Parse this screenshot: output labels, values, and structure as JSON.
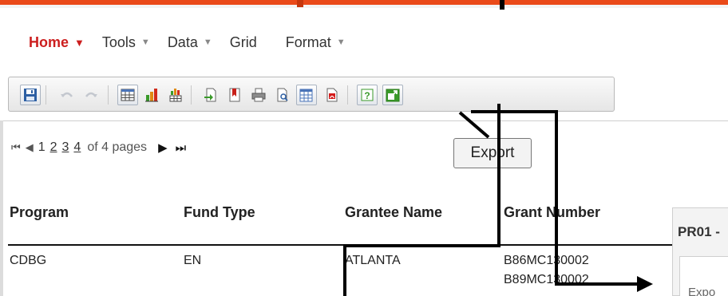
{
  "menu": {
    "items": [
      {
        "label": "Home",
        "active": true,
        "caret": "▼"
      },
      {
        "label": "Tools",
        "active": false,
        "caret": "▼"
      },
      {
        "label": "Data",
        "active": false,
        "caret": "▼"
      },
      {
        "label": "Grid",
        "active": false,
        "caret": ""
      },
      {
        "label": "Format",
        "active": false,
        "caret": "▼"
      }
    ]
  },
  "toolbar": {
    "buttons": [
      {
        "icon": "save-icon",
        "enabled": true
      },
      {
        "icon": "undo-icon",
        "enabled": false
      },
      {
        "icon": "redo-icon",
        "enabled": false
      },
      {
        "icon": "grid-view-icon",
        "enabled": true
      },
      {
        "icon": "graph-view-icon",
        "enabled": true
      },
      {
        "icon": "grid-and-graph-icon",
        "enabled": true
      },
      {
        "icon": "add-to-history-icon",
        "enabled": true
      },
      {
        "icon": "bookmark-icon",
        "enabled": true
      },
      {
        "icon": "print-icon",
        "enabled": true
      },
      {
        "icon": "print-preview-icon",
        "enabled": true
      },
      {
        "icon": "export-excel-icon",
        "enabled": true
      },
      {
        "icon": "export-pdf-icon",
        "enabled": true
      },
      {
        "icon": "help-icon",
        "enabled": true
      },
      {
        "icon": "maximize-icon",
        "enabled": true
      }
    ]
  },
  "pager": {
    "first": "⏮",
    "prev": "◀",
    "pages": [
      "1",
      "2",
      "3",
      "4"
    ],
    "current_page": "1",
    "summary": "of 4 pages",
    "next": "▶",
    "last": "⏭"
  },
  "tooltip": {
    "text": "Export"
  },
  "grid": {
    "columns": [
      "Program",
      "Fund Type",
      "Grantee Name",
      "Grant Number"
    ],
    "rows": [
      {
        "program": "CDBG",
        "fund_type": "EN",
        "grantee": "ATLANTA",
        "grant_numbers": [
          "B86MC130002",
          "B89MC130002"
        ]
      }
    ]
  },
  "side_panel": {
    "title": "PR01 -",
    "text": "Expo"
  },
  "colors": {
    "accent": "#ea4a19",
    "active_menu": "#cc1e1e"
  }
}
